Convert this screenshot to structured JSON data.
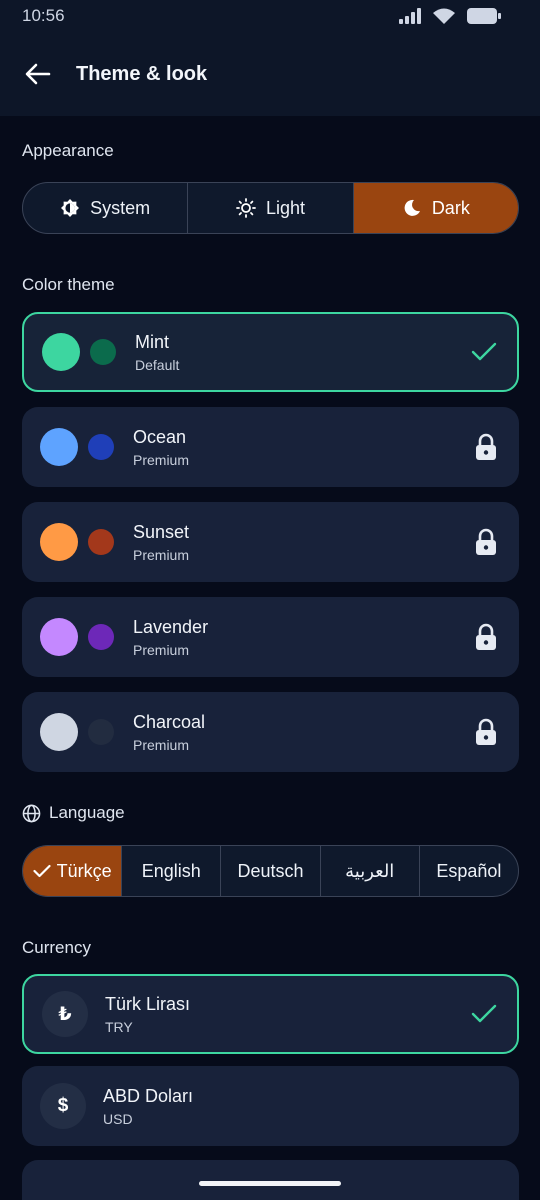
{
  "status": {
    "time": "10:56"
  },
  "header": {
    "title": "Theme & look"
  },
  "appearance": {
    "title": "Appearance",
    "options": [
      {
        "label": "System",
        "icon": "contrast-icon",
        "active": false
      },
      {
        "label": "Light",
        "icon": "sun-icon",
        "active": false
      },
      {
        "label": "Dark",
        "icon": "moon-icon",
        "active": true
      }
    ]
  },
  "color_theme": {
    "title": "Color theme",
    "themes": [
      {
        "name": "Mint",
        "sub": "Default",
        "primary": "#3dd6a0",
        "secondary": "#0b6b4c",
        "selected": true
      },
      {
        "name": "Ocean",
        "sub": "Premium",
        "primary": "#5ea3ff",
        "secondary": "#1f3fb8",
        "selected": false
      },
      {
        "name": "Sunset",
        "sub": "Premium",
        "primary": "#ff9a45",
        "secondary": "#a3381b",
        "selected": false
      },
      {
        "name": "Lavender",
        "sub": "Premium",
        "primary": "#c488ff",
        "secondary": "#6d28b8",
        "selected": false
      },
      {
        "name": "Charcoal",
        "sub": "Premium",
        "primary": "#cfd6e2",
        "secondary": "#222c40",
        "selected": false
      }
    ]
  },
  "language": {
    "title": "Language",
    "options": [
      {
        "label": "Türkçe",
        "active": true
      },
      {
        "label": "English",
        "active": false
      },
      {
        "label": "Deutsch",
        "active": false
      },
      {
        "label": "العربية",
        "active": false
      },
      {
        "label": "Español",
        "active": false
      }
    ]
  },
  "currency": {
    "title": "Currency",
    "items": [
      {
        "name": "Türk Lirası",
        "code": "TRY",
        "symbol": "₺",
        "selected": true
      },
      {
        "name": "ABD Doları",
        "code": "USD",
        "symbol": "$",
        "selected": false
      }
    ]
  },
  "colors": {
    "accent": "#3dd6a0",
    "active_segment": "#9a4510",
    "card": "#18223a",
    "background": "#060b1a"
  }
}
